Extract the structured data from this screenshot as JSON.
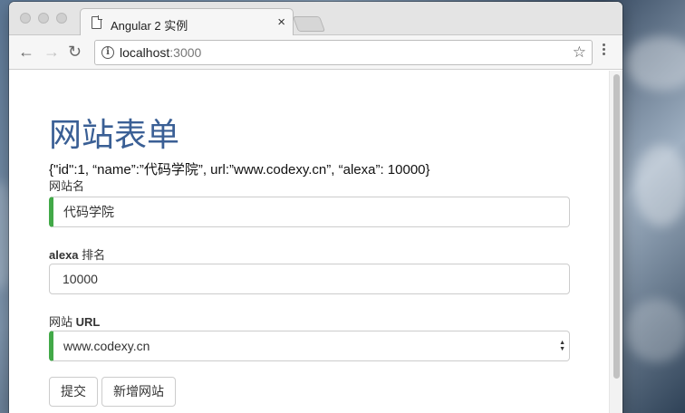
{
  "browser": {
    "tab_title": "Angular 2 实例",
    "tab_close": "×",
    "url_host": "localhost",
    "url_port": ":3000",
    "info_glyph": "i",
    "back_glyph": "←",
    "forward_glyph": "→",
    "reload_glyph": "↻",
    "star_glyph": "☆"
  },
  "page": {
    "title": "网站表单",
    "json_preview": "{\"id\":1, “name”:”代码学院”, url:”www.codexy.cn”, “alexa”: 10000}"
  },
  "form": {
    "name_label": "网站名",
    "name_value": "代码学院",
    "alexa_label_bold": "alexa",
    "alexa_label_rest": " 排名",
    "alexa_value": "10000",
    "url_label_pre": "网站 ",
    "url_label_bold": "URL",
    "url_selected": "www.codexy.cn",
    "submit_label": "提交",
    "add_site_label": "新增网站"
  },
  "colors": {
    "title": "#3a5f95",
    "valid_border": "#42a948"
  }
}
